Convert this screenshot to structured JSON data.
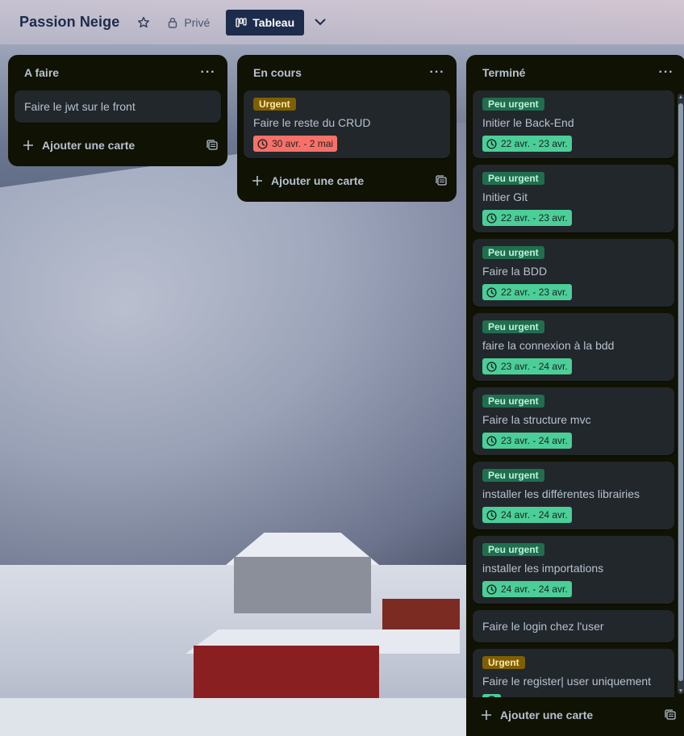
{
  "board": {
    "title": "Passion Neige",
    "visibility": "Privé",
    "view": "Tableau"
  },
  "add_card_label": "Ajouter une carte",
  "lists": [
    {
      "title": "A faire",
      "cards": [
        {
          "title": "Faire le jwt sur le front"
        }
      ]
    },
    {
      "title": "En cours",
      "cards": [
        {
          "label": "Urgent",
          "title": "Faire le reste du CRUD",
          "date": "30 avr. - 2 mai"
        }
      ]
    },
    {
      "title": "Terminé",
      "cards": [
        {
          "label": "Peu urgent",
          "title": "Initier le Back-End",
          "date": "22 avr. - 23 avr."
        },
        {
          "label": "Peu urgent",
          "title": "Initier Git",
          "date": "22 avr. - 23 avr."
        },
        {
          "label": "Peu urgent",
          "title": "Faire la BDD",
          "date": "22 avr. - 23 avr."
        },
        {
          "label": "Peu urgent",
          "title": "faire la connexion à la bdd",
          "date": "23 avr. - 24 avr."
        },
        {
          "label": "Peu urgent",
          "title": "Faire la structure mvc",
          "date": "23 avr. - 24 avr."
        },
        {
          "label": "Peu urgent",
          "title": "installer les différentes librairies",
          "date": "24 avr. - 24 avr."
        },
        {
          "label": "Peu urgent",
          "title": "installer les importations",
          "date": "24 avr. - 24 avr."
        },
        {
          "title": "Faire le login chez l'user"
        },
        {
          "label": "Urgent",
          "title": "Faire le register| user uniquement"
        }
      ]
    }
  ],
  "colors": {
    "list_bg": "#101204",
    "card_bg": "#22272b",
    "label_peu_urgent": "#216e4e",
    "label_urgent": "#7f5f01",
    "date_done": "#4bce97",
    "date_overdue": "#f87168",
    "header_button": "#1d2b4c"
  },
  "icons": {
    "star": "star-icon",
    "lock": "lock-icon",
    "board_view": "board-view-icon",
    "chevron": "chevron-down-icon",
    "more": "more-icon",
    "clock": "clock-icon",
    "plus": "plus-icon",
    "template": "card-template-icon"
  }
}
